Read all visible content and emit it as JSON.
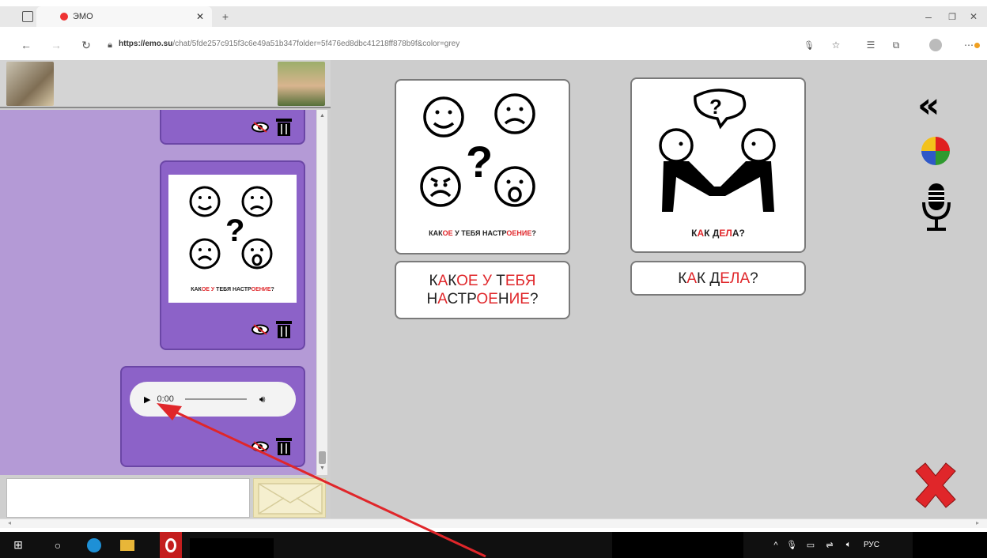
{
  "browser": {
    "tab_title": "ЭМО",
    "url_host": "https://emo.su",
    "url_path": "/chat/5fde257c915f3c6e49a51b347folder=5f476ed8dbc41218ff878b9f&color=grey"
  },
  "chat": {
    "card_caption_parts": [
      {
        "text": "КАК",
        "red": false
      },
      {
        "text": "ОЕ У ",
        "red": true
      },
      {
        "text": "ТЕБЯ ",
        "red": false
      },
      {
        "text": "НАСТР",
        "red": false
      },
      {
        "text": "ОЕНИЕ",
        "red": true
      },
      {
        "text": "?",
        "red": false
      }
    ],
    "audio_time": "0:00"
  },
  "tiles": [
    {
      "name": "mood",
      "caption_parts": [
        {
          "text": "КАК",
          "red": false
        },
        {
          "text": "ОЕ",
          "red": true
        },
        {
          "text": " У ",
          "red": false
        },
        {
          "text": "ТЕБЯ ",
          "red": false
        },
        {
          "text": "НАСТР",
          "red": false
        },
        {
          "text": "ОЕНИЕ",
          "red": true
        },
        {
          "text": "?",
          "red": false
        }
      ],
      "label_line1_parts": [
        {
          "text": "К",
          "red": false
        },
        {
          "text": "А",
          "red": true
        },
        {
          "text": "К",
          "red": false
        },
        {
          "text": "ОЕ У ",
          "red": true
        },
        {
          "text": "Т",
          "red": false
        },
        {
          "text": "ЕБЯ",
          "red": true
        }
      ],
      "label_line2_parts": [
        {
          "text": "Н",
          "red": false
        },
        {
          "text": "А",
          "red": true
        },
        {
          "text": "СТР",
          "red": false
        },
        {
          "text": "ОЕ",
          "red": true
        },
        {
          "text": "Н",
          "red": false
        },
        {
          "text": "ИЕ",
          "red": true
        },
        {
          "text": "?",
          "red": false
        }
      ]
    },
    {
      "name": "how-are-you",
      "caption_parts": [
        {
          "text": "К",
          "red": false
        },
        {
          "text": "А",
          "red": true
        },
        {
          "text": "К ",
          "red": false
        },
        {
          "text": "Д",
          "red": false
        },
        {
          "text": "ЕЛ",
          "red": true
        },
        {
          "text": "А",
          "red": false
        },
        {
          "text": "?",
          "red": false
        }
      ],
      "label_line1_parts": [
        {
          "text": "К",
          "red": false
        },
        {
          "text": "А",
          "red": true
        },
        {
          "text": "К ",
          "red": false
        },
        {
          "text": "Д",
          "red": false
        },
        {
          "text": "ЕЛ",
          "red": true
        },
        {
          "text": "А",
          "red": true
        },
        {
          "text": "?",
          "red": false
        }
      ]
    }
  ],
  "side_icons": [
    "collapse-icon",
    "color-wheel-icon",
    "microphone-icon",
    "close-icon"
  ],
  "taskbar": {
    "language": "РУС"
  },
  "colors": {
    "chat_bg": "#b49ad6",
    "bubble": "#8c62c8",
    "panel_bg": "#cdcdcd",
    "accent_red": "#e0262a"
  }
}
